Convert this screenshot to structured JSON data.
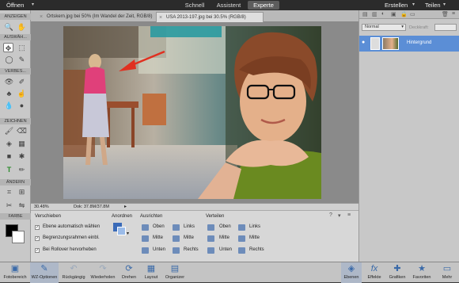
{
  "menu": {
    "open_label": "Öffnen"
  },
  "modes": [
    "Schnell",
    "Assistent",
    "Experte"
  ],
  "top_right": {
    "create": "Erstellen",
    "share": "Teilen"
  },
  "toolbox": {
    "sections": [
      "ANZEIGEN",
      "AUSWÄH...",
      "VERBES...",
      "ZEICHNEN",
      "ÄNDERN",
      "FARBE"
    ]
  },
  "tabs": [
    {
      "title": "Ortskern.jpg bei 50% (Im Wandel der Zeit, RGB/8)"
    },
    {
      "title": "USA 2013-197.jpg bei 30.5% (RGB/8)"
    }
  ],
  "status": {
    "zoom": "30.48%",
    "doc": "Dok: 37.8M/37.8M"
  },
  "options": {
    "move_title": "Verschieben",
    "checks": [
      "Ebene automatisch wählen",
      "Begrenzungsrahmen einbl.",
      "Bei Rollover hervorheben"
    ],
    "arrange_title": "Anordnen",
    "align_title": "Ausrichten",
    "align": [
      "Oben",
      "Links",
      "Mitte",
      "Mitte",
      "Unten",
      "Rechts"
    ],
    "distribute_title": "Verteilen",
    "distribute": [
      "Oben",
      "Links",
      "Mitte",
      "Mitte",
      "Unten",
      "Rechts"
    ]
  },
  "layers": {
    "blend_mode": "Normal",
    "opacity_label": "Deckkraft:",
    "layer_name": "Hintergrund"
  },
  "bottom_left": [
    "Fotobereich",
    "WZ-Optionen",
    "Rückgängig",
    "Wiederholen",
    "Drehen",
    "Layout",
    "Organizer"
  ],
  "bottom_right": [
    "Ebenen",
    "Effekte",
    "Grafiken",
    "Favoriten",
    "Mehr"
  ],
  "colors": {
    "accent": "#5b8ed6",
    "arrow": "#e03020"
  }
}
